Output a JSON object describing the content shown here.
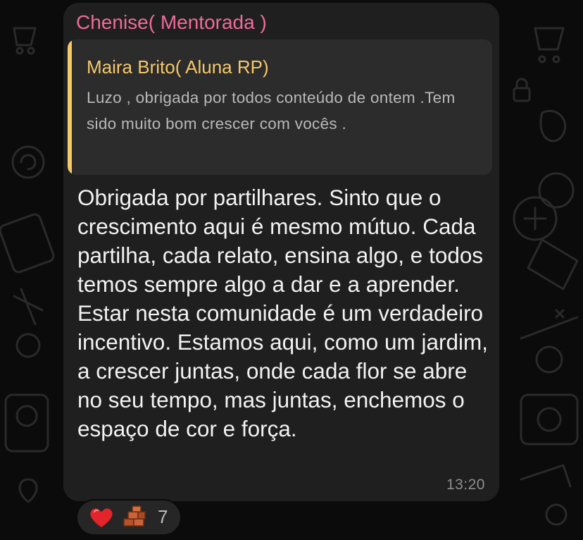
{
  "message": {
    "sender": "Chenise( Mentorada )",
    "reply": {
      "author": "Maira Brito( Aluna RP)",
      "text": "Luzo , obrigada por todos conteúdo de ontem .Tem sido muito bom crescer com vocês ."
    },
    "text": "Obrigada por partilhares. Sinto que o crescimento aqui é mesmo mútuo. Cada partilha, cada relato, ensina algo, e todos temos sempre algo a dar e a aprender. Estar nesta comunidade é um verdadeiro incentivo. Estamos aqui, como um jardim, a crescer juntas, onde cada flor se abre no seu tempo, mas juntas, enchemos o espaço de cor e força.",
    "time": "13:20"
  },
  "reactions": {
    "icons": [
      "red-heart-icon",
      "bricks-icon"
    ],
    "count": "7"
  },
  "colors": {
    "background": "#0b0b0b",
    "bubble": "#1f1f1f",
    "sender": "#f06b9a",
    "quote_accent": "#f5c86a",
    "quote_bg": "#2c2c2c"
  }
}
